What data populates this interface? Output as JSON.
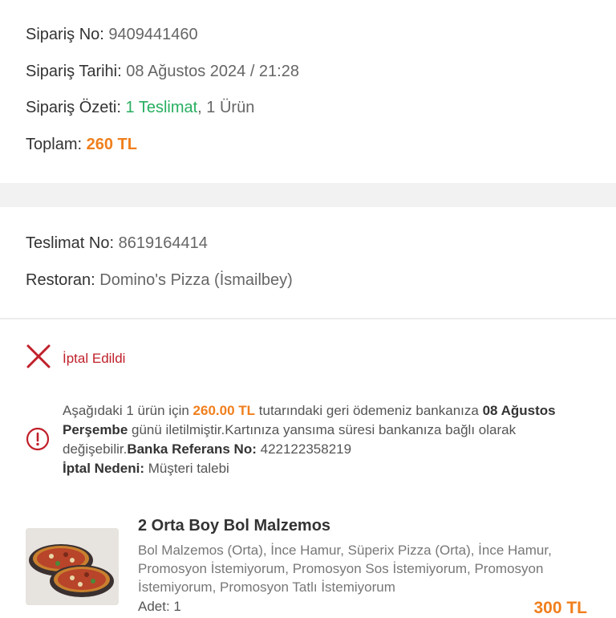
{
  "order": {
    "no_label": "Sipariş No:",
    "no_value": "9409441460",
    "date_label": "Sipariş Tarihi:",
    "date_value": "08 Ağustos 2024 / 21:28",
    "summary_label": "Sipariş Özeti:",
    "summary_delivery": "1 Teslimat",
    "summary_rest": ", 1 Ürün",
    "total_label": "Toplam:",
    "total_value": "260 TL"
  },
  "delivery": {
    "no_label": "Teslimat No:",
    "no_value": "8619164414",
    "restaurant_label": "Restoran:",
    "restaurant_value": "Domino's Pizza (İsmailbey)"
  },
  "status": {
    "text": "İptal Edildi",
    "icon": "close-icon",
    "color": "#c0202a"
  },
  "refund": {
    "icon": "info-icon",
    "p1": "Aşağıdaki 1 ürün için ",
    "amount": "260.00 TL",
    "p2": " tutarındaki geri ödemeniz bankanıza ",
    "date": "08 Ağustos Perşembe",
    "p3": " günü iletilmiştir.Kartınıza yansıma süresi bankanıza bağlı olarak değişebilir.",
    "ref_label": "Banka Referans No:",
    "ref_value": " 422122358219",
    "reason_label": "İptal Nedeni:",
    "reason_value": " Müşteri talebi"
  },
  "product": {
    "name": "2 Orta Boy Bol Malzemos",
    "description": "Bol Malzemos (Orta), İnce Hamur, Süperix Pizza (Orta), İnce Hamur, Promosyon İstemiyorum, Promosyon Sos İstemiyorum, Promosyon İstemiyorum, Promosyon Tatlı İstemiyorum",
    "qty": "Adet: 1",
    "price": "300 TL"
  },
  "colors": {
    "accent": "#f07f1d",
    "green": "#27ae60",
    "cancel_red": "#c0202a"
  }
}
